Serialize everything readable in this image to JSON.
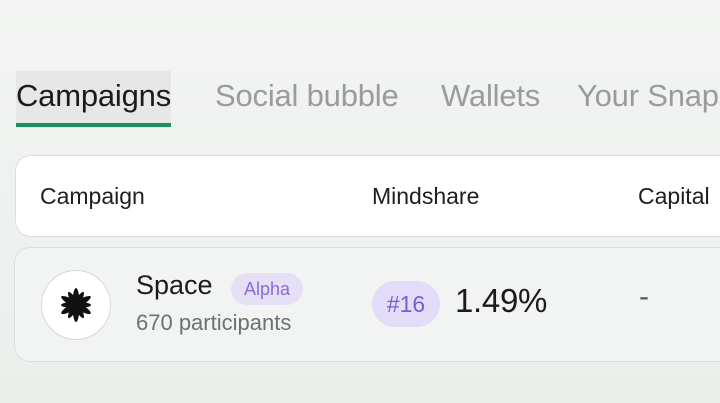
{
  "tabs": [
    {
      "label": "Campaigns",
      "active": true
    },
    {
      "label": "Social bubble",
      "active": false
    },
    {
      "label": "Wallets",
      "active": false
    },
    {
      "label": "Your Snaps",
      "active": false
    }
  ],
  "table": {
    "columns": [
      "Campaign",
      "Mindshare",
      "Capital"
    ],
    "rows": [
      {
        "icon": "starburst-logo-icon",
        "name": "Space",
        "badge": "Alpha",
        "participants": "670 participants",
        "rank": "#16",
        "mindshare": "1.49%",
        "capital": "-"
      }
    ]
  },
  "colors": {
    "accent_green": "#17925f",
    "badge_purple": "#8b6ad8",
    "badge_bg": "#e6e0f7"
  }
}
